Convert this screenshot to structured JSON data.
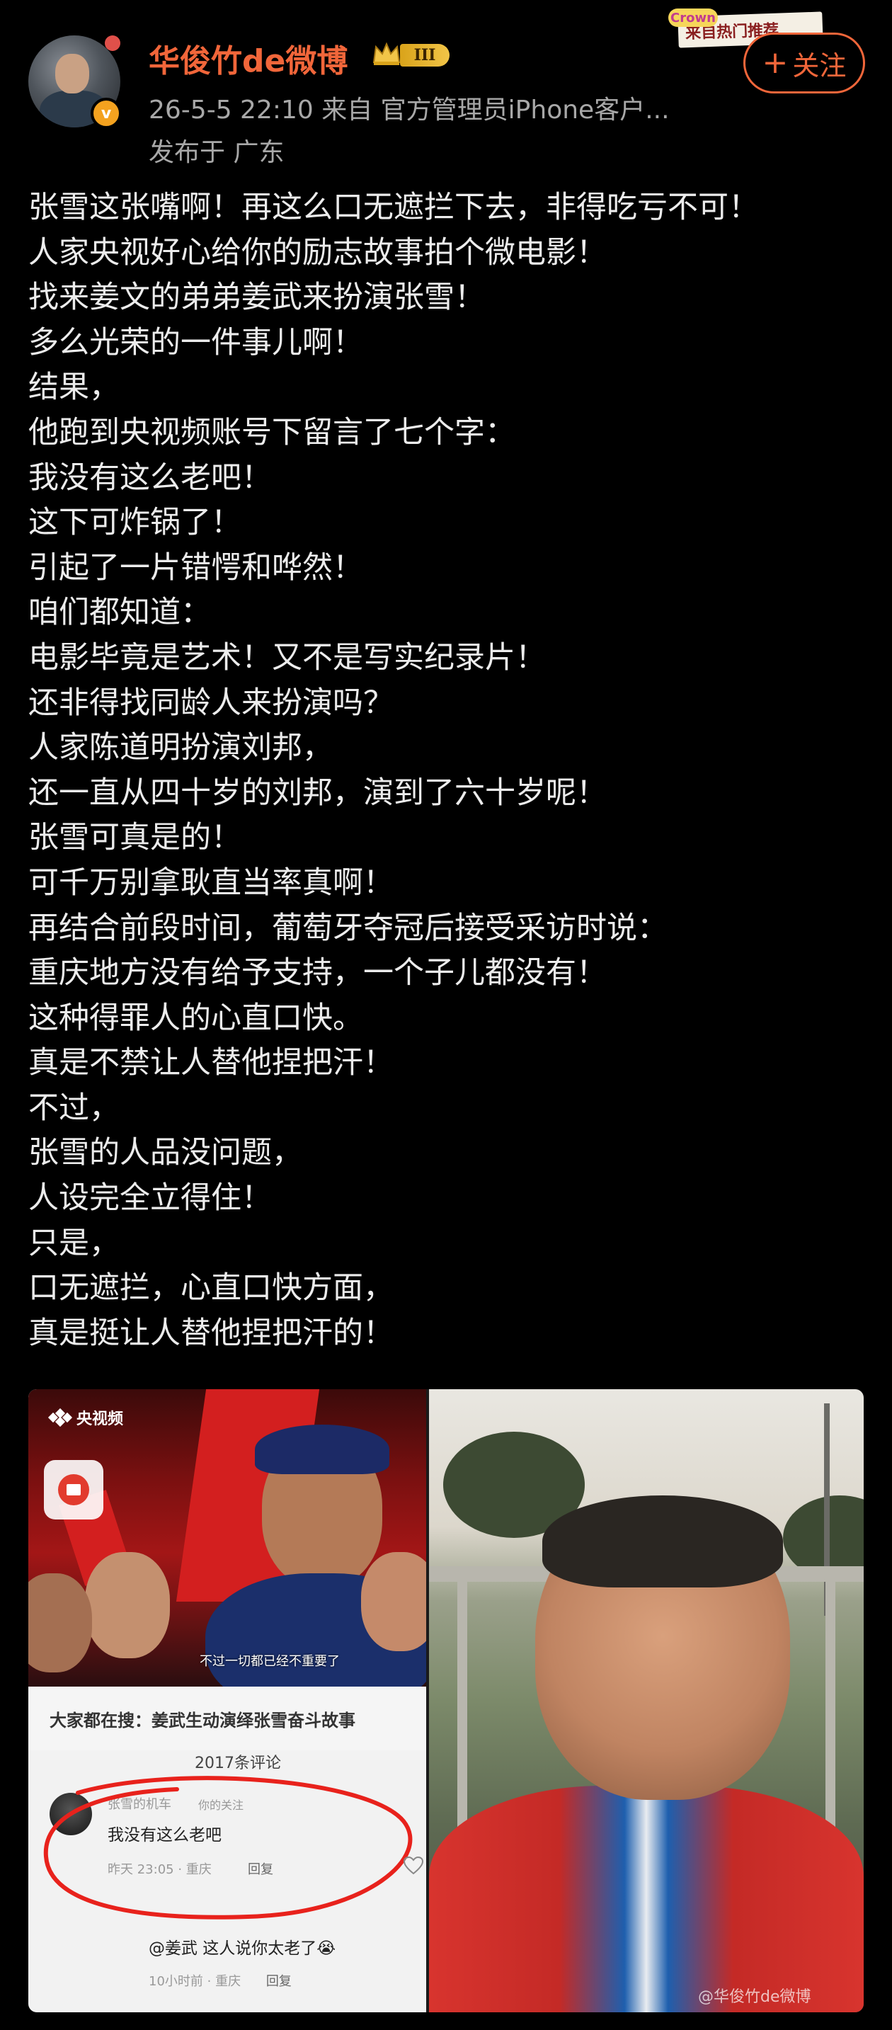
{
  "header": {
    "username": "华俊竹de微博",
    "level": "III",
    "meta": "26-5-5 22:10  来自 官方管理员iPhone客户...",
    "location": "发布于 广东",
    "verified_mark": "v",
    "follow_label": "关注",
    "follow_plus": "+",
    "hot_tag": "来自热门推荐",
    "hot_tag_crown": "Crown"
  },
  "post": {
    "lines": [
      "张雪这张嘴啊！再这么口无遮拦下去，非得吃亏不可！",
      "人家央视好心给你的励志故事拍个微电影！",
      "找来姜文的弟弟姜武来扮演张雪！",
      "多么光荣的一件事儿啊！",
      "结果，",
      "他跑到央视频账号下留言了七个字：",
      "我没有这么老吧！",
      "这下可炸锅了！",
      "引起了一片错愕和哗然！",
      "咱们都知道：",
      "电影毕竟是艺术！又不是写实纪录片！",
      "还非得找同龄人来扮演吗？",
      "人家陈道明扮演刘邦，",
      "还一直从四十岁的刘邦，演到了六十岁呢！",
      "张雪可真是的！",
      "可千万别拿耿直当率真啊！",
      "再结合前段时间，葡萄牙夺冠后接受采访时说：",
      "重庆地方没有给予支持，一个子儿都没有！",
      "这种得罪人的心直口快。",
      "真是不禁让人替他捏把汗！",
      "不过，",
      "张雪的人品没问题，",
      "人设完全立得住！",
      "只是，",
      "口无遮拦，心直口快方面，",
      "真是挺让人替他捏把汗的！"
    ]
  },
  "image_left": {
    "cctv_label": "央视频",
    "subtitle": "不过一切都已经不重要了",
    "search_bar": "大家都在搜：姜武生动演绎张雪奋斗故事",
    "comment_count": "2017条评论",
    "comment": {
      "user": "张雪的机车",
      "follow_tag": "你的关注",
      "text": "我没有这么老吧",
      "time": "昨天 23:05 · 重庆",
      "reply": "回复"
    },
    "reply2": {
      "text": "@姜武 这人说你太老了😭",
      "time": "10小时前 · 重庆",
      "reply": "回复"
    }
  },
  "image_right": {
    "watermark": "@华俊竹de微博"
  },
  "colors": {
    "accent": "#f1663a",
    "background": "#000000",
    "text": "#ececec",
    "meta": "#a8a8a8"
  }
}
